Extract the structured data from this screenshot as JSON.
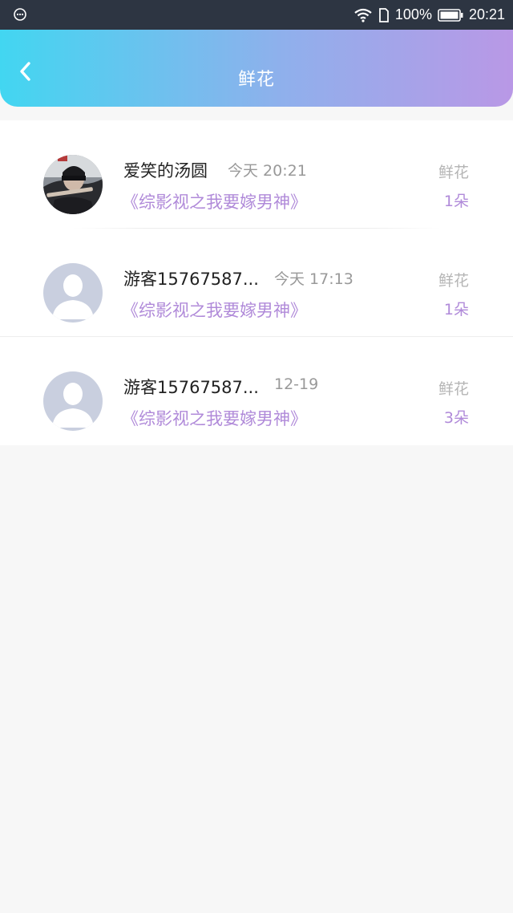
{
  "status_bar": {
    "battery": "100%",
    "time": "20:21",
    "icons": [
      "message-icon",
      "wifi-icon",
      "sim-icon",
      "battery-icon"
    ]
  },
  "header": {
    "title": "鲜花",
    "back_icon": "chevron-left-icon",
    "gradient": [
      "#42d6f1",
      "#b998e6"
    ]
  },
  "colors": {
    "accent": "#b08ad9",
    "muted": "#999999"
  },
  "records": [
    {
      "name": "爱笑的汤圆",
      "time": "今天 20:21",
      "work": "《综影视之我要嫁男神》",
      "gift_label": "鲜花",
      "gift_count": "1朵",
      "avatar": "photo-avatar"
    },
    {
      "name": "游客15767587...",
      "time": "今天 17:13",
      "work": "《综影视之我要嫁男神》",
      "gift_label": "鲜花",
      "gift_count": "1朵",
      "avatar": "default-avatar"
    },
    {
      "name": "游客15767587...",
      "time": "12-19",
      "work": "《综影视之我要嫁男神》",
      "gift_label": "鲜花",
      "gift_count": "3朵",
      "avatar": "default-avatar"
    }
  ]
}
